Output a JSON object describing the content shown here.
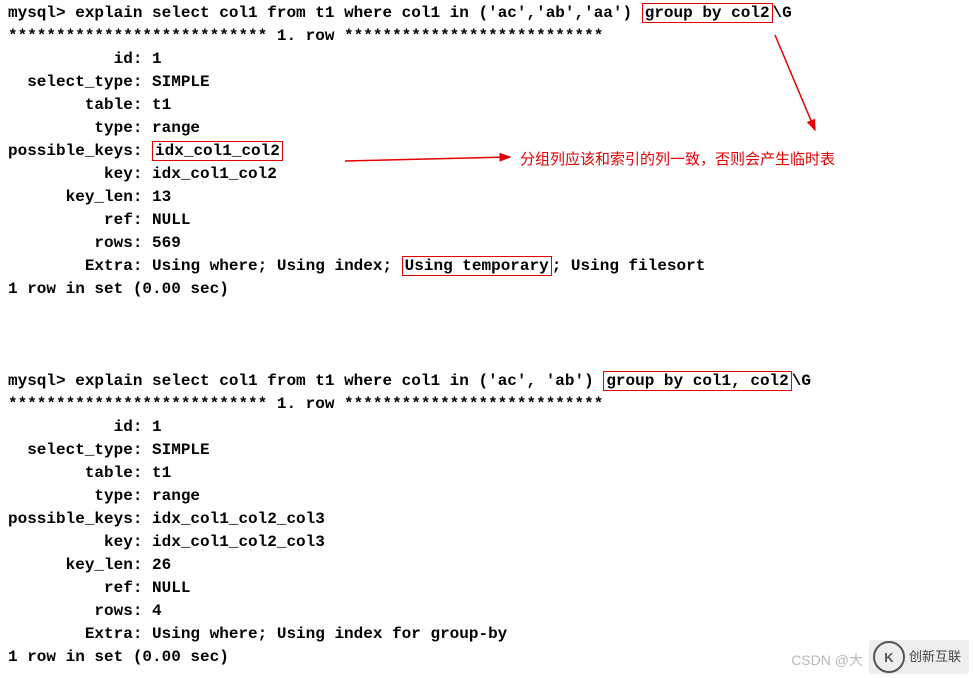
{
  "query1": {
    "prompt": "mysql> ",
    "cmd_before": "explain select col1 from t1 where col1 in ('ac','ab','aa') ",
    "cmd_boxed": "group by col2",
    "cmd_after": "\\G",
    "sep": "*************************** 1. row ***************************",
    "rows": [
      "           id: 1",
      "  select_type: SIMPLE",
      "        table: t1",
      "         type: range"
    ],
    "pk_label": "possible_keys: ",
    "pk_boxed": "idx_col1_col2",
    "rows2": [
      "          key: idx_col1_col2",
      "      key_len: 13",
      "          ref: NULL",
      "         rows: 569"
    ],
    "extra_label": "        Extra: ",
    "extra_before": "Using where; Using index; ",
    "extra_boxed": "Using temporary",
    "extra_after": "; Using filesort",
    "footer": "1 row in set (0.00 sec)"
  },
  "query2": {
    "prompt": "mysql> ",
    "cmd_before": "explain select col1 from t1 where col1 in ('ac', 'ab') ",
    "cmd_boxed": "group by col1, col2",
    "cmd_after": "\\G",
    "sep": "*************************** 1. row ***************************",
    "rows": [
      "           id: 1",
      "  select_type: SIMPLE",
      "        table: t1",
      "         type: range",
      "possible_keys: idx_col1_col2_col3",
      "          key: idx_col1_col2_col3",
      "      key_len: 26",
      "          ref: NULL",
      "         rows: 4",
      "        Extra: Using where; Using index for group-by"
    ],
    "footer": "1 row in set (0.00 sec)"
  },
  "annotation": "分组列应该和索引的列一致，否则会产生临时表",
  "watermark": "CSDN @大",
  "logo_text": "创新互联"
}
